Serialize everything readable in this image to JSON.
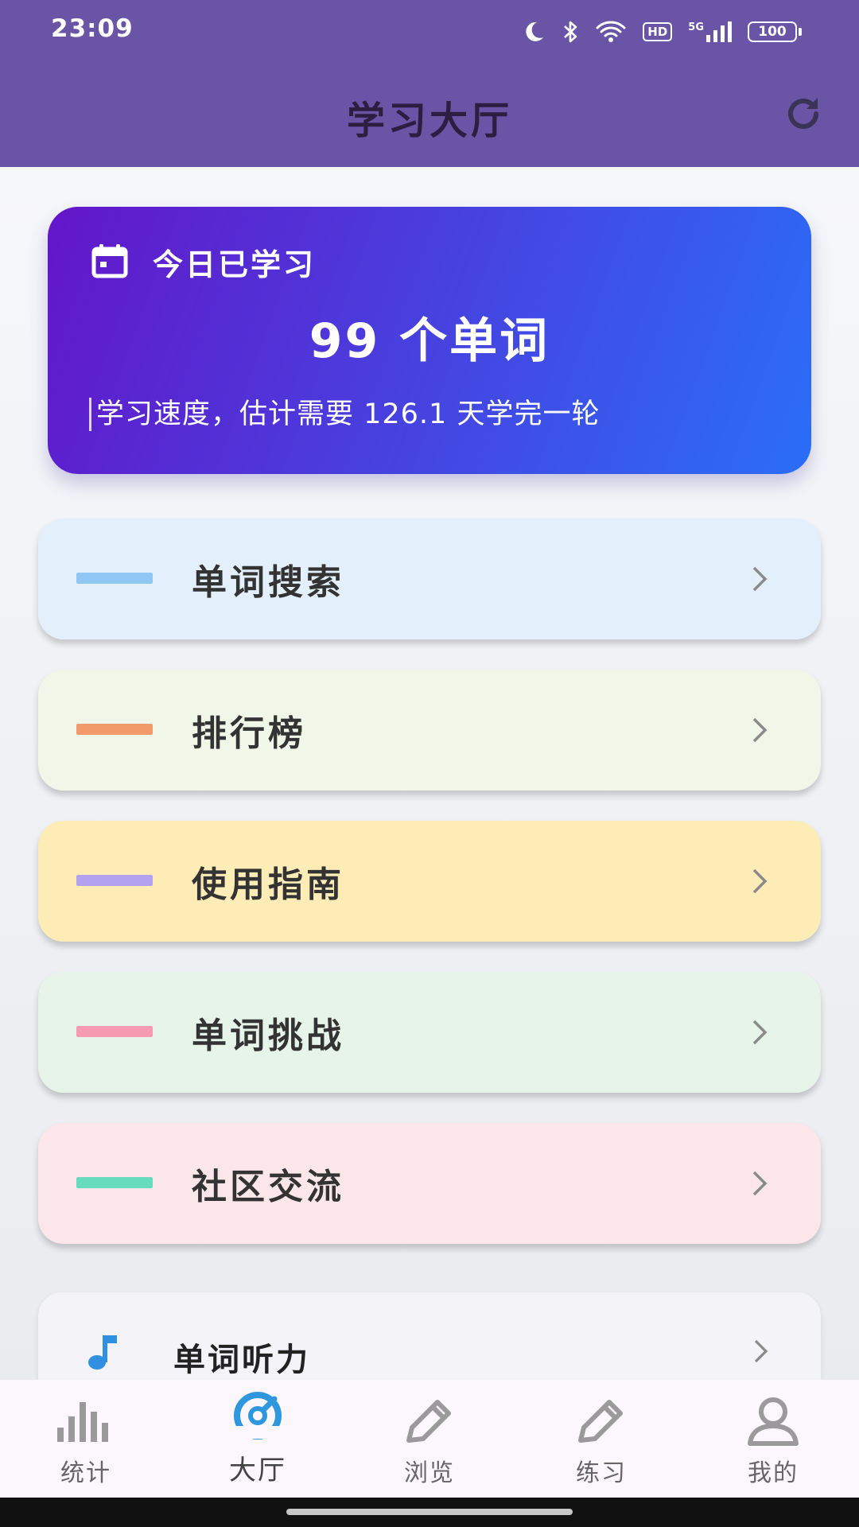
{
  "status_bar": {
    "time": "23:09",
    "hd_badge": "HD",
    "network": "5G",
    "battery": "100",
    "icons": [
      "moon-icon",
      "bluetooth-icon",
      "wifi-icon",
      "hd-icon",
      "signal-icon",
      "battery-icon"
    ]
  },
  "app_bar": {
    "title": "学习大厅",
    "refresh_icon": "refresh-icon"
  },
  "today_card": {
    "label": "今日已学习",
    "count_text": "99 个单词",
    "note": "学习速度，估计需要 126.1 天学完一轮",
    "icon": "calendar-icon"
  },
  "menu": [
    {
      "label": "单词搜索",
      "bg": "#e3f0fb",
      "thumb": "#8fc7f5"
    },
    {
      "label": "排行榜",
      "bg": "#f0f6e8",
      "thumb": "#f29a6a"
    },
    {
      "label": "使用指南",
      "bg": "#fdecb6",
      "thumb": "#b3a2ef"
    },
    {
      "label": "单词挑战",
      "bg": "#e6f4e9",
      "thumb": "#f59ab0"
    },
    {
      "label": "社区交流",
      "bg": "#fbe6ea",
      "thumb": "#66dcbc"
    }
  ],
  "listen_card": {
    "label": "单词听力",
    "icon": "music-note-icon"
  },
  "bottom_nav": [
    {
      "label": "统计",
      "icon": "bar-chart-icon",
      "active": false
    },
    {
      "label": "大厅",
      "icon": "gauge-icon",
      "active": true
    },
    {
      "label": "浏览",
      "icon": "pencil-icon",
      "active": false
    },
    {
      "label": "练习",
      "icon": "pencil-icon",
      "active": false
    },
    {
      "label": "我的",
      "icon": "person-icon",
      "active": false
    }
  ],
  "colors": {
    "header": "#6a54a6",
    "accent": "#2f97dd",
    "card_gradient_start": "#6316c9",
    "card_gradient_end": "#2a6ef7"
  }
}
